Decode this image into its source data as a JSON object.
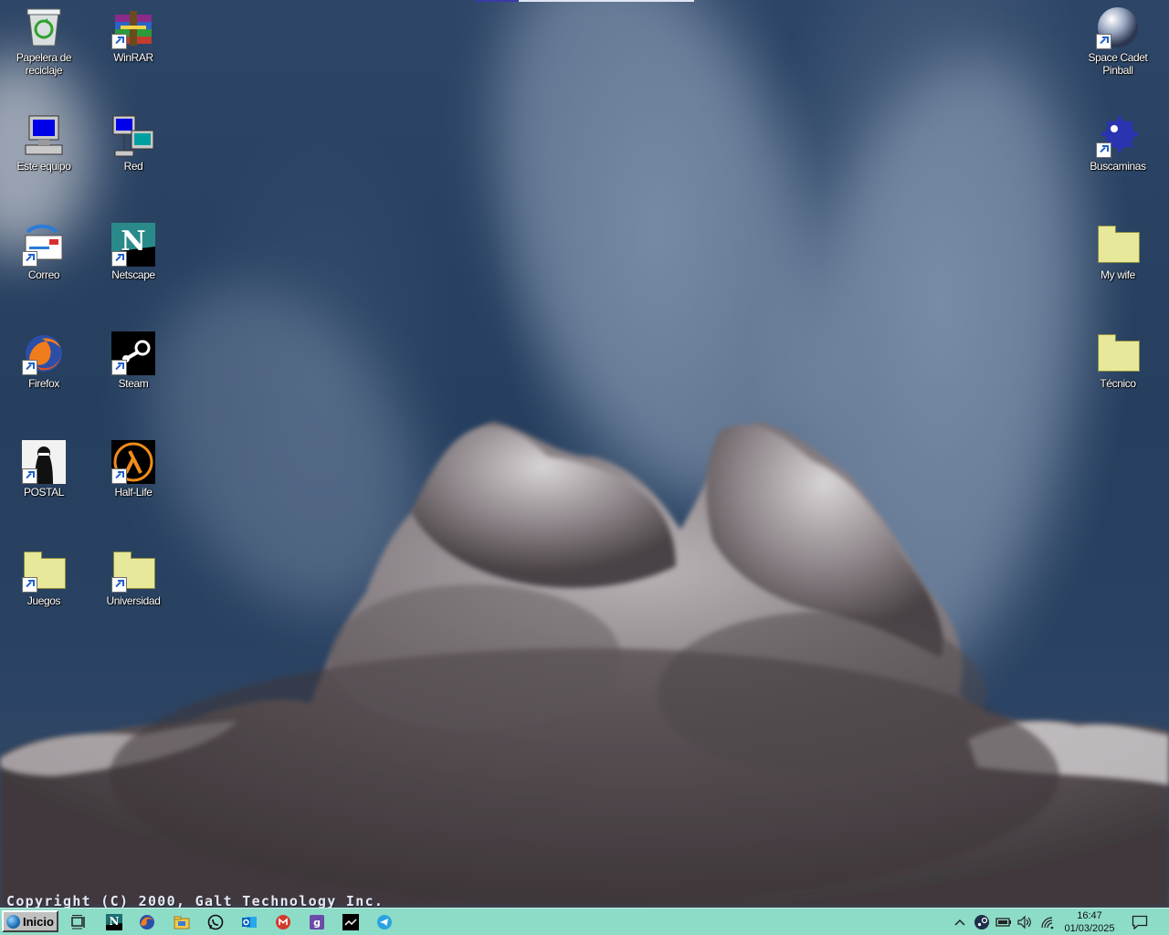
{
  "wallpaper": {
    "copyright": "Copyright (C) 2000, Galt Technology Inc."
  },
  "desktop": {
    "icons": [
      {
        "label": "Papelera de reciclaje",
        "icon": "recycle-bin-icon"
      },
      {
        "label": "WinRAR",
        "icon": "winrar-icon"
      },
      {
        "label": "Space Cadet Pinball",
        "icon": "pinball-icon"
      },
      {
        "label": "Este equipo",
        "icon": "computer-icon"
      },
      {
        "label": "Red",
        "icon": "network-icon"
      },
      {
        "label": "Buscaminas",
        "icon": "mine-icon"
      },
      {
        "label": "Correo",
        "icon": "mail-icon"
      },
      {
        "label": "Netscape",
        "icon": "netscape-icon"
      },
      {
        "label": "My wife",
        "icon": "folder-icon"
      },
      {
        "label": "Firefox",
        "icon": "firefox-icon"
      },
      {
        "label": "Steam",
        "icon": "steam-icon"
      },
      {
        "label": "Técnico",
        "icon": "folder-icon"
      },
      {
        "label": "POSTAL",
        "icon": "postal-icon"
      },
      {
        "label": "Half-Life",
        "icon": "half-life-icon"
      },
      {
        "label": "Juegos",
        "icon": "folder-icon"
      },
      {
        "label": "Universidad",
        "icon": "folder-icon"
      }
    ]
  },
  "taskbar": {
    "start_label": "Inicio",
    "pinned": [
      "task-view-icon",
      "netscape-icon",
      "firefox-icon",
      "file-explorer-icon",
      "whatsapp-icon",
      "outlook-icon",
      "gmail-icon",
      "gog-icon",
      "steam-icon",
      "telegram-icon"
    ],
    "tray": [
      "chevron-up-icon",
      "steam-icon",
      "battery-icon",
      "volume-icon",
      "wifi-icon"
    ],
    "clock": {
      "time": "16:47",
      "date": "01/03/2025"
    },
    "notification_icon": "notification-icon"
  }
}
